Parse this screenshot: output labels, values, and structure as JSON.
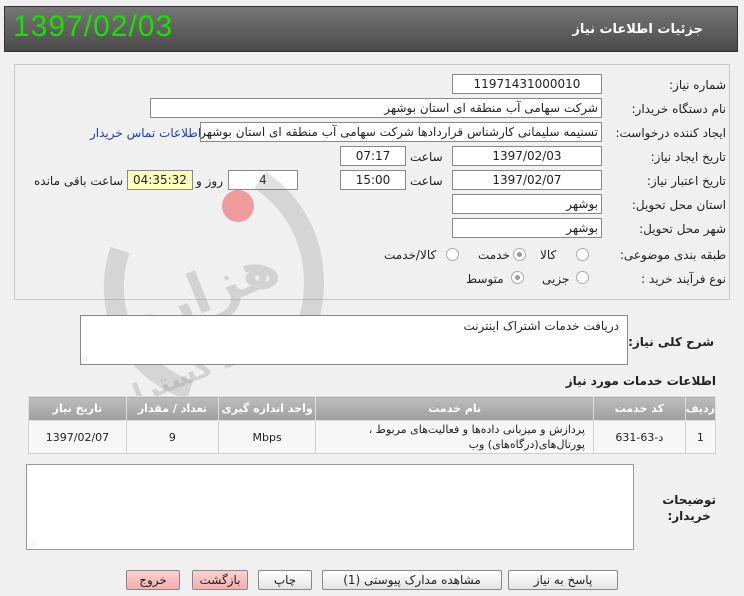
{
  "header": {
    "date": "1397/02/03",
    "title": "جزئیات اطلاعات نیاز"
  },
  "form": {
    "need_number_label": "شماره نیاز:",
    "need_number": "11971431000010",
    "buyer_org_label": "نام دستگاه خریدار:",
    "buyer_org": "شرکت سهامی آب منطقه ای استان بوشهر",
    "creator_label": "ایجاد کننده درخواست:",
    "creator": "تسنیمه سلیمانی کارشناس قراردادها شرکت سهامی آب منطقه ای استان بوشهر",
    "contact_link": "اطلاعات تماس خریدار",
    "created_date_label": "تاریخ ایجاد نیاز:",
    "created_date": "1397/02/03",
    "time_label": "ساعت",
    "created_time": "07:17",
    "validity_label": "تاریخ اعتبار نیاز:",
    "validity_date": "1397/02/07",
    "validity_time": "15:00",
    "days": "4",
    "days_label": "روز و",
    "remaining": "04:35:32",
    "remaining_label": "ساعت باقی مانده",
    "province_label": "استان محل تحویل:",
    "province": "بوشهر",
    "city_label": "شهر محل تحویل:",
    "city": "بوشهر",
    "category_label": "طبقه بندی موضوعی:",
    "category_options": [
      "کالا",
      "خدمت",
      "کالا/خدمت"
    ],
    "category_selected": "خدمت",
    "purchase_type_label": "نوع فرآیند خرید :",
    "purchase_type_options": [
      "جزیی",
      "متوسط"
    ],
    "purchase_type_selected": "متوسط"
  },
  "description": {
    "label": "شرح کلی نیاز:",
    "text": "دریافت خدمات اشتراک اینترنت"
  },
  "services": {
    "title": "اطلاعات خدمات مورد نیاز",
    "headers": [
      "ردیف",
      "کد خدمت",
      "نام خدمت",
      "واحد اندازه گیری",
      "تعداد / مقدار",
      "تاریخ نیاز"
    ],
    "rows": [
      {
        "row": "1",
        "code": "د-63-631",
        "name": "پردازش و میزبانی داده‌ها و فعالیت‌های مربوط ، پورتال‌های(درگاه‌های) وب",
        "unit": "Mbps",
        "qty": "9",
        "date": "1397/02/07"
      }
    ]
  },
  "notes": {
    "label_line1": "توضیحات",
    "label_line2": "خریدار:"
  },
  "buttons": {
    "reply": "پاسخ به نیاز",
    "attachments": "مشاهده مدارک پیوستی (1)",
    "print": "چاپ",
    "back": "بازگشت",
    "exit": "خروج"
  },
  "watermark": {
    "text": "هزاره ارتباط گستران"
  }
}
